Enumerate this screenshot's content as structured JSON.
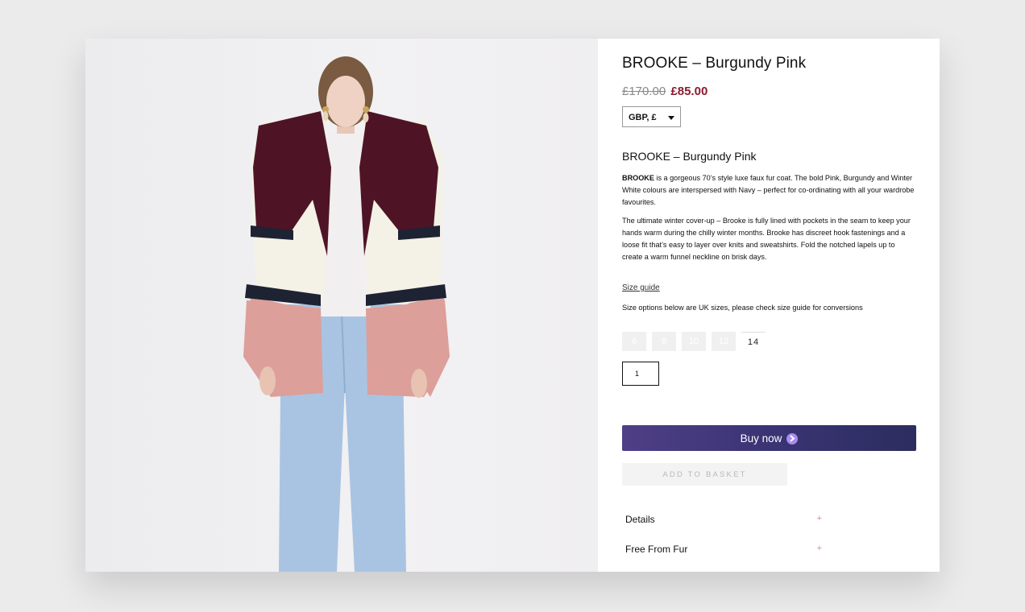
{
  "product": {
    "title": "BROOKE – Burgundy Pink",
    "price_old": "£170.00",
    "price_new": "£85.00",
    "currency_selected": "GBP, £",
    "subtitle": "BROOKE – Burgundy Pink",
    "description": {
      "p1_bold": "BROOKE",
      "p1_rest": " is a gorgeous 70’s style luxe faux fur coat.  The bold Pink, Burgundy and Winter White colours are interspersed with Navy – perfect for co-ordinating with all your wardrobe favourites.",
      "p2": "The ultimate winter cover-up – Brooke is fully lined with pockets in the seam to keep your hands warm during the chilly winter months. Brooke has discreet hook fastenings and a loose fit that’s easy to layer over knits and sweatshirts. Fold the notched lapels up to create a warm funnel neckline on brisk days."
    },
    "size_guide_label": "Size guide",
    "size_note": "Size options below are UK sizes, please check size guide for conversions",
    "sizes": [
      {
        "label": "6",
        "available": false
      },
      {
        "label": "8",
        "available": false
      },
      {
        "label": "10",
        "available": false
      },
      {
        "label": "12",
        "available": false
      },
      {
        "label": "14",
        "available": true
      }
    ],
    "quantity": "1",
    "buy_now_label": "Buy now",
    "add_to_basket_label": "ADD TO BASKET",
    "accordions": [
      {
        "label": "Details",
        "icon": "+"
      },
      {
        "label": "Free From Fur",
        "icon": "+"
      }
    ]
  },
  "colors": {
    "sale_price": "#8a1c31",
    "buy_button_start": "#4f3f86",
    "buy_button_end": "#2c2d5f",
    "coat_burgundy": "#4e1426",
    "coat_cream": "#f4f1e6",
    "coat_pink": "#dc9f9a",
    "coat_navy": "#1d2333",
    "jeans": "#a9c4e2"
  }
}
